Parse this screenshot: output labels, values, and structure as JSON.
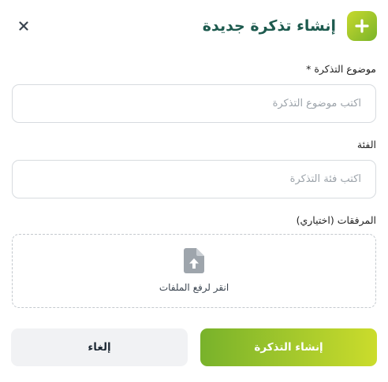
{
  "dialog": {
    "title": "إنشاء تذكرة جديدة",
    "add_icon": "plus-icon",
    "close_icon": "close-icon"
  },
  "form": {
    "subject": {
      "label": "موضوع التذكرة *",
      "placeholder": "اكتب موضوع التذكرة",
      "value": ""
    },
    "category": {
      "label": "الفئة",
      "placeholder": "اكتب فئة التذكرة",
      "value": ""
    },
    "attachments": {
      "label": "المرفقات (اختياري)",
      "upload_text": "انقر لرفع الملفات",
      "icon": "file-upload-icon"
    }
  },
  "actions": {
    "create_label": "إنشاء التذكرة",
    "cancel_label": "إلغاء"
  },
  "colors": {
    "accent_start": "#78b22b",
    "accent_end": "#cbdc2c",
    "title": "#1d5a4e",
    "cancel_bg": "#f1f2f4"
  }
}
